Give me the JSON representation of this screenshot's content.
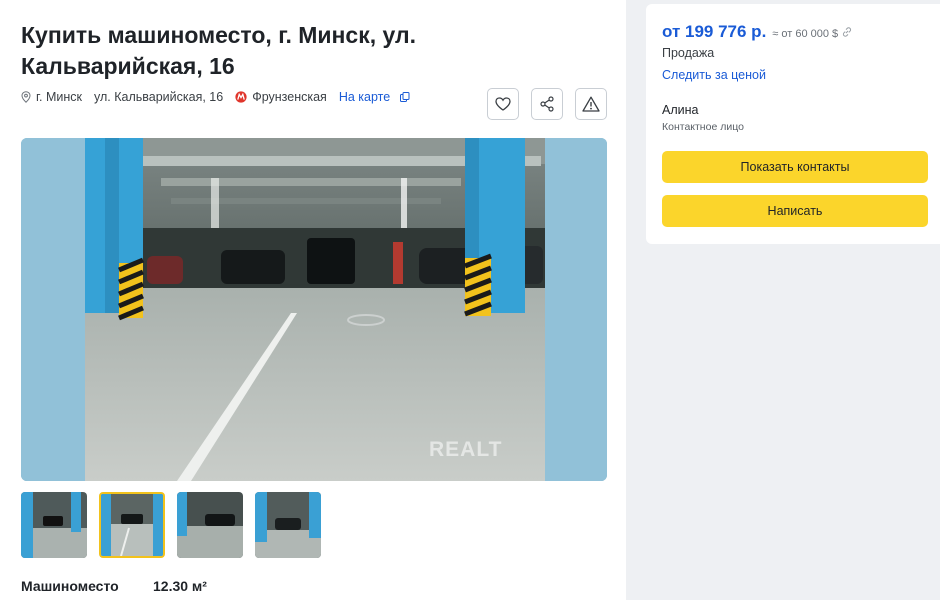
{
  "listing": {
    "title": "Купить машиноместо, г. Минск, ул. Кальварийская, 16",
    "city": "г. Минск",
    "street": "ул. Кальварийская, 16",
    "metro": "Фрунзенская",
    "map_link": "На карте",
    "watermark": "REALT"
  },
  "actions": {
    "favorite_icon": "heart-icon",
    "share_icon": "share-icon",
    "report_icon": "warning-icon"
  },
  "gallery": {
    "thumbnail_count": 4,
    "active_index": 1
  },
  "specs": [
    {
      "label": "Машиноместо",
      "value": "12.30 м²"
    }
  ],
  "sidebar": {
    "price": "от 199 776 р.",
    "price_usd": "≈ от 60 000 $",
    "deal_type": "Продажа",
    "track_price": "Следить за ценой",
    "seller_name": "Алина",
    "seller_role": "Контактное лицо",
    "show_contacts": "Показать контакты",
    "write": "Написать"
  },
  "colors": {
    "accent_blue": "#1a5bd6",
    "button_yellow": "#fbd52b",
    "page_bg": "#eef0f3",
    "metro_red": "#e0352b"
  }
}
